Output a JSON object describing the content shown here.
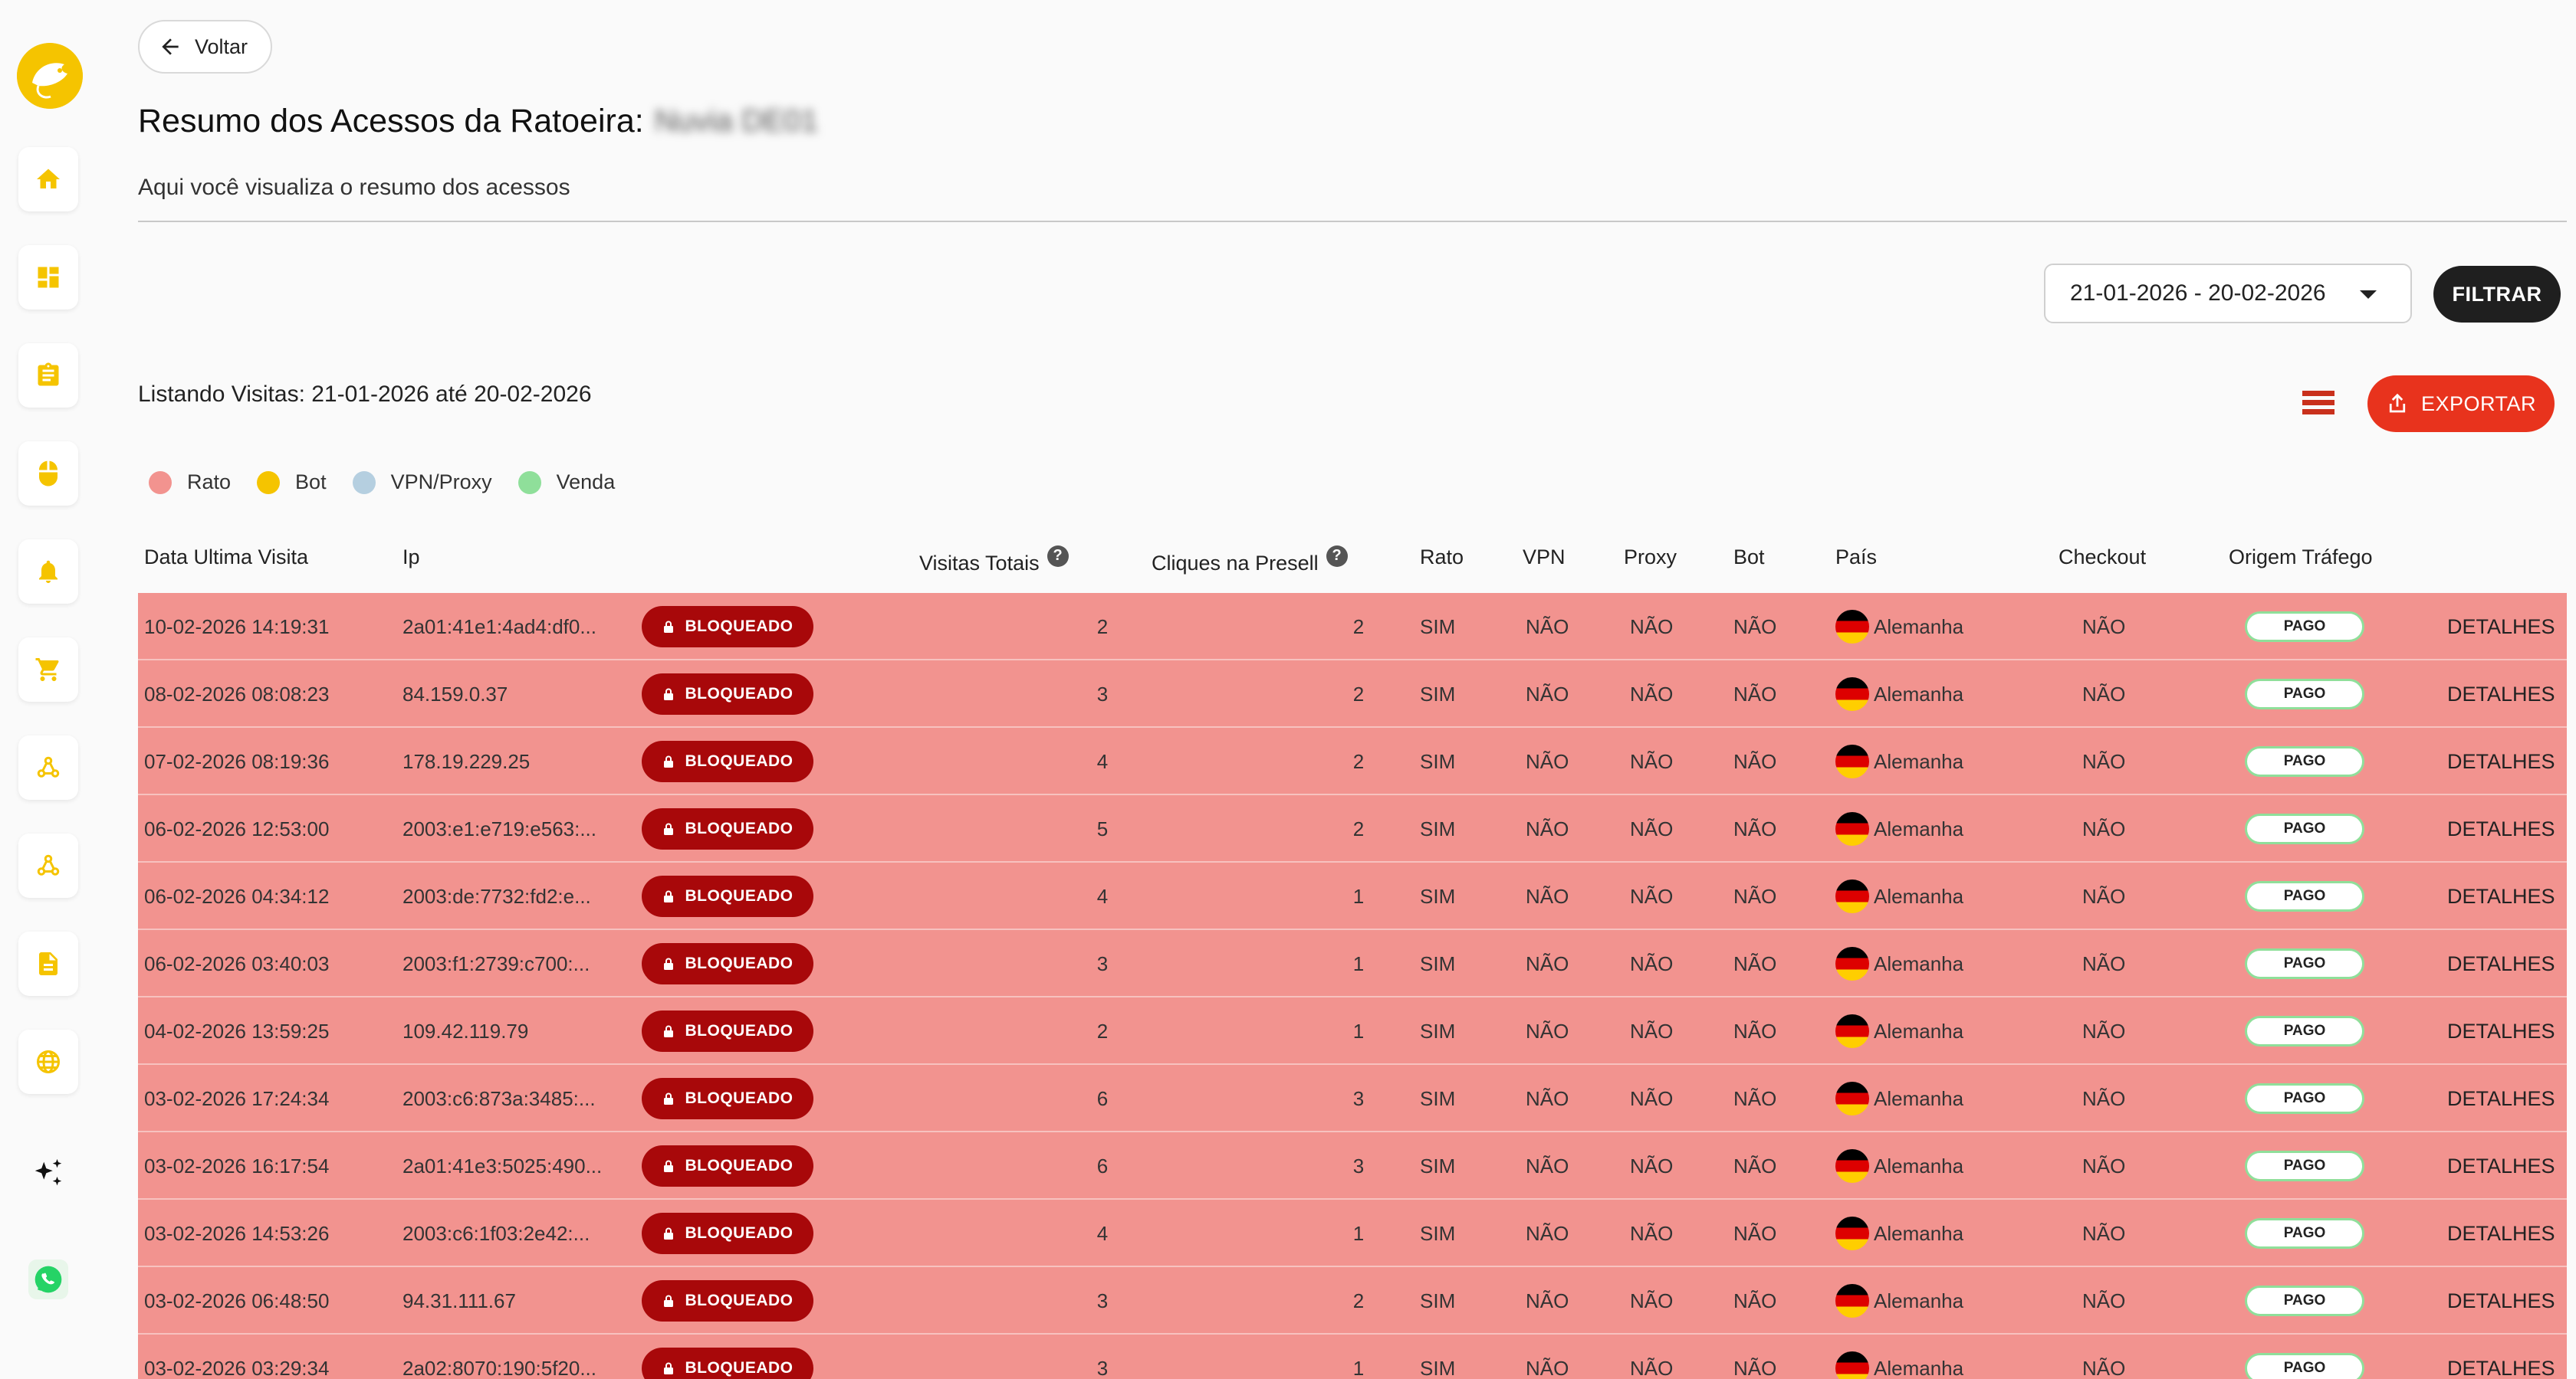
{
  "sidebar": {
    "icons": [
      "home-icon",
      "dashboard-icon",
      "clipboard-icon",
      "mouse-icon",
      "bell-icon",
      "cart-icon",
      "webhook-icon",
      "webhook-icon-2",
      "document-icon",
      "globe-icon",
      "sparkles-icon",
      "whatsapp-icon"
    ]
  },
  "header": {
    "back_label": "Voltar",
    "title": "Resumo dos Acessos da Ratoeira:",
    "title_blurred": "Nuvia DE01",
    "subtitle": "Aqui você visualiza o resumo dos acessos"
  },
  "filter": {
    "date_range": "21-01-2026 - 20-02-2026",
    "filter_label": "FILTRAR"
  },
  "listing": {
    "text": "Listando Visitas: 21-01-2026 até 20-02-2026",
    "export_label": "EXPORTAR"
  },
  "legend": [
    {
      "label": "Rato",
      "color": "#f2938f"
    },
    {
      "label": "Bot",
      "color": "#f5c400"
    },
    {
      "label": "VPN/Proxy",
      "color": "#b5cfe0"
    },
    {
      "label": "Venda",
      "color": "#8fdf9a"
    }
  ],
  "table": {
    "headers": {
      "date": "Data Ultima Visita",
      "ip": "Ip",
      "visits": "Visitas Totais",
      "clicks": "Cliques na Presell",
      "rato": "Rato",
      "vpn": "VPN",
      "proxy": "Proxy",
      "bot": "Bot",
      "country": "País",
      "checkout": "Checkout",
      "origin": "Origem Tráfego",
      "help": "?"
    },
    "rows": [
      {
        "date": "10-02-2026 14:19:31",
        "ip": "2a01:41e1:4ad4:df0...",
        "status": "BLOQUEADO",
        "visits": "2",
        "clicks": "2",
        "rato": "SIM",
        "vpn": "NÃO",
        "proxy": "NÃO",
        "bot": "NÃO",
        "country": "Alemanha",
        "checkout": "NÃO",
        "origin": "PAGO",
        "action": "DETALHES"
      },
      {
        "date": "08-02-2026 08:08:23",
        "ip": "84.159.0.37",
        "status": "BLOQUEADO",
        "visits": "3",
        "clicks": "2",
        "rato": "SIM",
        "vpn": "NÃO",
        "proxy": "NÃO",
        "bot": "NÃO",
        "country": "Alemanha",
        "checkout": "NÃO",
        "origin": "PAGO",
        "action": "DETALHES"
      },
      {
        "date": "07-02-2026 08:19:36",
        "ip": "178.19.229.25",
        "status": "BLOQUEADO",
        "visits": "4",
        "clicks": "2",
        "rato": "SIM",
        "vpn": "NÃO",
        "proxy": "NÃO",
        "bot": "NÃO",
        "country": "Alemanha",
        "checkout": "NÃO",
        "origin": "PAGO",
        "action": "DETALHES"
      },
      {
        "date": "06-02-2026 12:53:00",
        "ip": "2003:e1:e719:e563:...",
        "status": "BLOQUEADO",
        "visits": "5",
        "clicks": "2",
        "rato": "SIM",
        "vpn": "NÃO",
        "proxy": "NÃO",
        "bot": "NÃO",
        "country": "Alemanha",
        "checkout": "NÃO",
        "origin": "PAGO",
        "action": "DETALHES"
      },
      {
        "date": "06-02-2026 04:34:12",
        "ip": "2003:de:7732:fd2:e...",
        "status": "BLOQUEADO",
        "visits": "4",
        "clicks": "1",
        "rato": "SIM",
        "vpn": "NÃO",
        "proxy": "NÃO",
        "bot": "NÃO",
        "country": "Alemanha",
        "checkout": "NÃO",
        "origin": "PAGO",
        "action": "DETALHES"
      },
      {
        "date": "06-02-2026 03:40:03",
        "ip": "2003:f1:2739:c700:...",
        "status": "BLOQUEADO",
        "visits": "3",
        "clicks": "1",
        "rato": "SIM",
        "vpn": "NÃO",
        "proxy": "NÃO",
        "bot": "NÃO",
        "country": "Alemanha",
        "checkout": "NÃO",
        "origin": "PAGO",
        "action": "DETALHES"
      },
      {
        "date": "04-02-2026 13:59:25",
        "ip": "109.42.119.79",
        "status": "BLOQUEADO",
        "visits": "2",
        "clicks": "1",
        "rato": "SIM",
        "vpn": "NÃO",
        "proxy": "NÃO",
        "bot": "NÃO",
        "country": "Alemanha",
        "checkout": "NÃO",
        "origin": "PAGO",
        "action": "DETALHES"
      },
      {
        "date": "03-02-2026 17:24:34",
        "ip": "2003:c6:873a:3485:...",
        "status": "BLOQUEADO",
        "visits": "6",
        "clicks": "3",
        "rato": "SIM",
        "vpn": "NÃO",
        "proxy": "NÃO",
        "bot": "NÃO",
        "country": "Alemanha",
        "checkout": "NÃO",
        "origin": "PAGO",
        "action": "DETALHES"
      },
      {
        "date": "03-02-2026 16:17:54",
        "ip": "2a01:41e3:5025:490...",
        "status": "BLOQUEADO",
        "visits": "6",
        "clicks": "3",
        "rato": "SIM",
        "vpn": "NÃO",
        "proxy": "NÃO",
        "bot": "NÃO",
        "country": "Alemanha",
        "checkout": "NÃO",
        "origin": "PAGO",
        "action": "DETALHES"
      },
      {
        "date": "03-02-2026 14:53:26",
        "ip": "2003:c6:1f03:2e42:...",
        "status": "BLOQUEADO",
        "visits": "4",
        "clicks": "1",
        "rato": "SIM",
        "vpn": "NÃO",
        "proxy": "NÃO",
        "bot": "NÃO",
        "country": "Alemanha",
        "checkout": "NÃO",
        "origin": "PAGO",
        "action": "DETALHES"
      },
      {
        "date": "03-02-2026 06:48:50",
        "ip": "94.31.111.67",
        "status": "BLOQUEADO",
        "visits": "3",
        "clicks": "2",
        "rato": "SIM",
        "vpn": "NÃO",
        "proxy": "NÃO",
        "bot": "NÃO",
        "country": "Alemanha",
        "checkout": "NÃO",
        "origin": "PAGO",
        "action": "DETALHES"
      },
      {
        "date": "03-02-2026 03:29:34",
        "ip": "2a02:8070:190:5f20...",
        "status": "BLOQUEADO",
        "visits": "3",
        "clicks": "1",
        "rato": "SIM",
        "vpn": "NÃO",
        "proxy": "NÃO",
        "bot": "NÃO",
        "country": "Alemanha",
        "checkout": "NÃO",
        "origin": "PAGO",
        "action": "DETALHES"
      }
    ]
  }
}
